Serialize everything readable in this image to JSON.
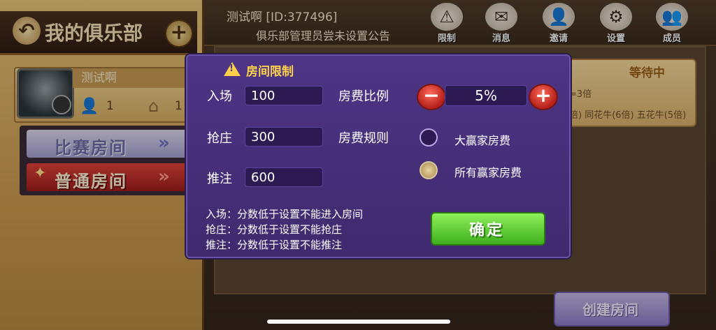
{
  "left": {
    "title": "我的俱乐部",
    "profile": {
      "name": "测试啊",
      "members": "1",
      "rooms": "1"
    },
    "menu": {
      "match_room": "比赛房间",
      "normal_room": "普通房间",
      "arrows": "»"
    }
  },
  "header": {
    "club_id_text": "测试啊 [ID:377496]",
    "announcement": "俱乐部管理员尝未设置公告",
    "buttons": [
      {
        "label": "限制",
        "icon": "warning-icon"
      },
      {
        "label": "消息",
        "icon": "mail-icon"
      },
      {
        "label": "邀请",
        "icon": "add-user-icon"
      },
      {
        "label": "设置",
        "icon": "gear-icon"
      },
      {
        "label": "成员",
        "icon": "members-icon"
      }
    ]
  },
  "room_card": {
    "status": "等待中",
    "line1": "=3倍",
    "line2": "倍) 同花牛(6倍) 五花牛(5倍)"
  },
  "create_room_label": "创建房间",
  "dialog": {
    "title": "房间限制",
    "entry_label": "入场",
    "entry_value": "100",
    "banker_label": "抢庄",
    "banker_value": "300",
    "bet_label": "推注",
    "bet_value": "600",
    "fee_ratio_label": "房费比例",
    "fee_ratio_value": "5%",
    "fee_rule_label": "房费规则",
    "fee_rule_options": [
      "大赢家房费",
      "所有赢家房费"
    ],
    "fee_rule_selected": "所有赢家房费",
    "notes": [
      "入场：分数低于设置不能进入房间",
      "抢庄：分数低于设置不能抢庄",
      "推注：分数低于设置不能推注"
    ],
    "confirm_label": "确定"
  },
  "colors": {
    "dialog_bg": "#4e3586",
    "title_accent": "#ffd24a",
    "confirm_green": "#3fb01e",
    "stepper_red": "#b4201a"
  }
}
